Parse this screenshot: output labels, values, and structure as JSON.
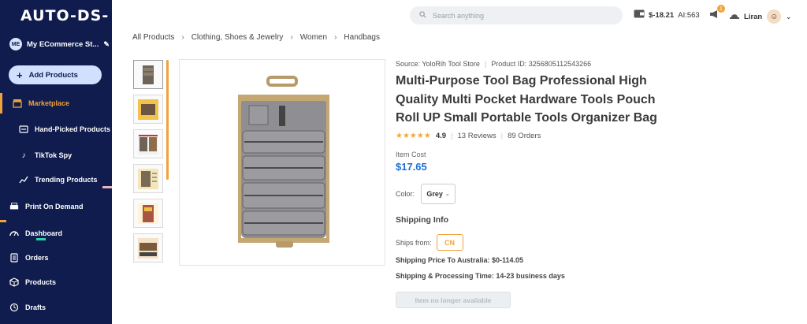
{
  "sidebar": {
    "logo": "AUTO-DS-",
    "store_initials": "ME",
    "store_name": "My ECommerce St...",
    "add_products": "Add Products",
    "items": [
      {
        "label": "Marketplace",
        "icon": "store-icon"
      },
      {
        "label": "Hand-Picked Products",
        "icon": "hand-icon"
      },
      {
        "label": "TikTok Spy",
        "icon": "tiktok-icon"
      },
      {
        "label": "Trending Products",
        "icon": "trend-icon"
      },
      {
        "label": "Print On Demand",
        "icon": "printer-icon"
      },
      {
        "label": "Dashboard",
        "icon": "gauge-icon"
      },
      {
        "label": "Orders",
        "icon": "clipboard-icon"
      },
      {
        "label": "Products",
        "icon": "box-icon"
      },
      {
        "label": "Drafts",
        "icon": "drafts-icon"
      }
    ]
  },
  "topbar": {
    "search_placeholder": "Search anything",
    "balance": "$-18.21",
    "ai_credits": "AI:563",
    "notifications": "1",
    "user_name": "Liran"
  },
  "breadcrumb": [
    "All Products",
    "Clothing, Shoes & Jewelry",
    "Women",
    "Handbags"
  ],
  "product": {
    "source": "Source: YoloRih Tool Store",
    "product_id": "Product ID: 3256805112543266",
    "title": "Multi-Purpose Tool Bag Professional High Quality Multi Pocket Hardware Tools Pouch Roll UP Small Portable Tools Organizer Bag",
    "rating_value": 4.9,
    "rating": "4.9",
    "reviews": "13 Reviews",
    "orders": "89 Orders",
    "cost_label": "Item Cost",
    "price": "$17.65",
    "color_label": "Color:",
    "color_value": "Grey",
    "shipping_heading": "Shipping Info",
    "ships_from_label": "Ships from:",
    "ships_from_value": "CN",
    "shipping_price": "Shipping Price To Australia:  $0-114.05",
    "shipping_time": "Shipping & Processing Time:  14-23 business days",
    "unavailable": "Item no longer available"
  },
  "colors": {
    "sidebar_bg": "#0f1c4d",
    "accent": "#f0a33a",
    "price": "#1d6fd1"
  }
}
